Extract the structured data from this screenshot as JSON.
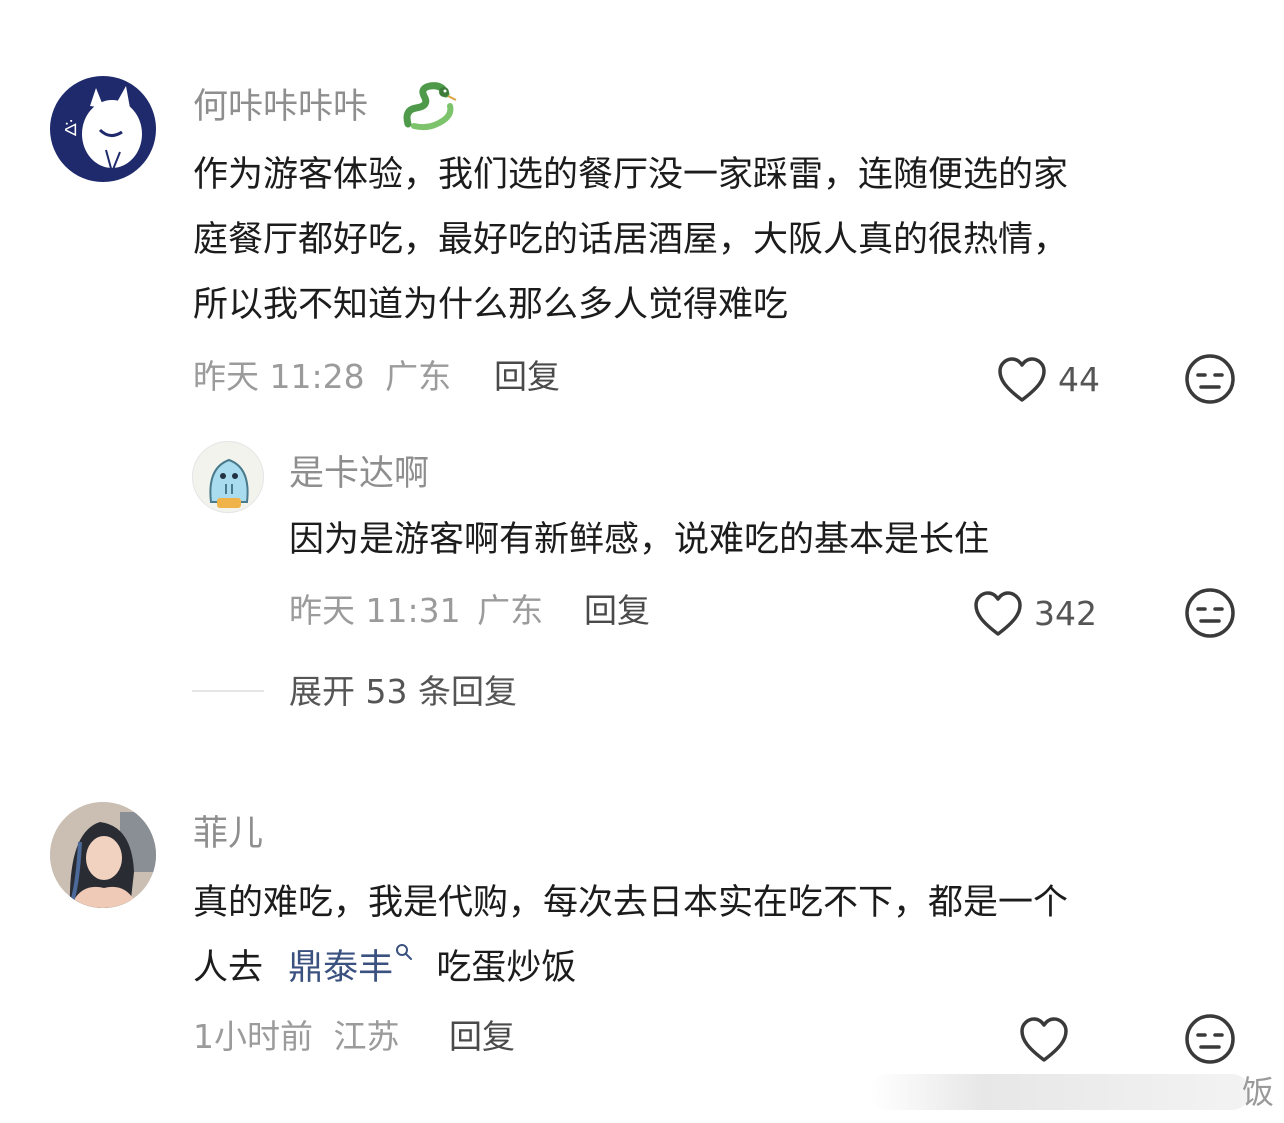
{
  "comments": [
    {
      "username": "何咔咔咔咔",
      "text_lines": [
        "作为游客体验，我们选的餐厅没一家踩雷，连随便选的家",
        "庭餐厅都好吃，最好吃的话居酒屋，大阪人真的很热情，",
        "所以我不知道为什么那么多人觉得难吃"
      ],
      "time": "昨天 11:28",
      "location": "广东",
      "reply_label": "回复",
      "likes": "44",
      "reply": {
        "username": "是卡达啊",
        "text": "因为是游客啊有新鲜感，说难吃的基本是长住",
        "time": "昨天 11:31",
        "location": "广东",
        "reply_label": "回复",
        "likes": "342"
      },
      "expand_label": "展开 53 条回复"
    },
    {
      "username": "菲儿",
      "text_line1": "真的难吃，我是代购，每次去日本实在吃不下，都是一个",
      "text_line2_pre": "人去",
      "search_link": "鼎泰丰",
      "text_line2_post": "吃蛋炒饭",
      "time": "1小时前",
      "location": "江苏",
      "reply_label": "回复",
      "likes": ""
    }
  ],
  "watermark_char": "饭",
  "colors": {
    "link": "#3b5280",
    "meta": "#9b9b9b",
    "username": "#8e8e8e"
  }
}
